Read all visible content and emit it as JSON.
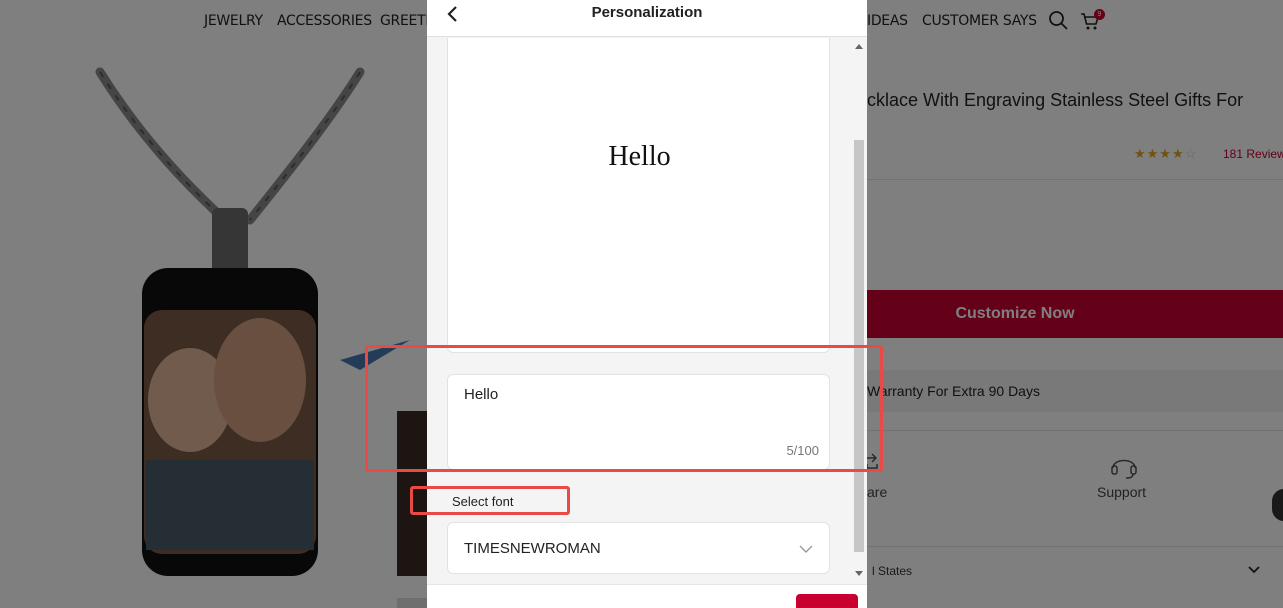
{
  "nav": {
    "items": [
      "JEWELRY",
      "ACCESSORIES",
      "GREETI",
      "IDEAS",
      "CUSTOMER SAYS"
    ],
    "cart_count": "9"
  },
  "product": {
    "title": "cklace With Engraving Stainless Steel Gifts For",
    "rating_stars": 4,
    "reviews": "181 Review",
    "customize_label": "Customize Now",
    "warranty_text": "Warranty For Extra 90 Days",
    "share_label": "are",
    "support_label": "Support",
    "shipping_label": "l States"
  },
  "modal": {
    "title": "Personalization",
    "preview_text": "Hello",
    "input_value": "Hello",
    "char_count": "5/100",
    "font_label": "Select font",
    "font_value": "TIMESNEWROMAN"
  },
  "colors": {
    "accent": "#c8002f",
    "highlight": "#e84b46",
    "star": "#e0a21b"
  },
  "icons": [
    "search-icon",
    "cart-icon",
    "back-arrow-icon",
    "chevron-down-icon",
    "headset-icon",
    "share-icon"
  ]
}
